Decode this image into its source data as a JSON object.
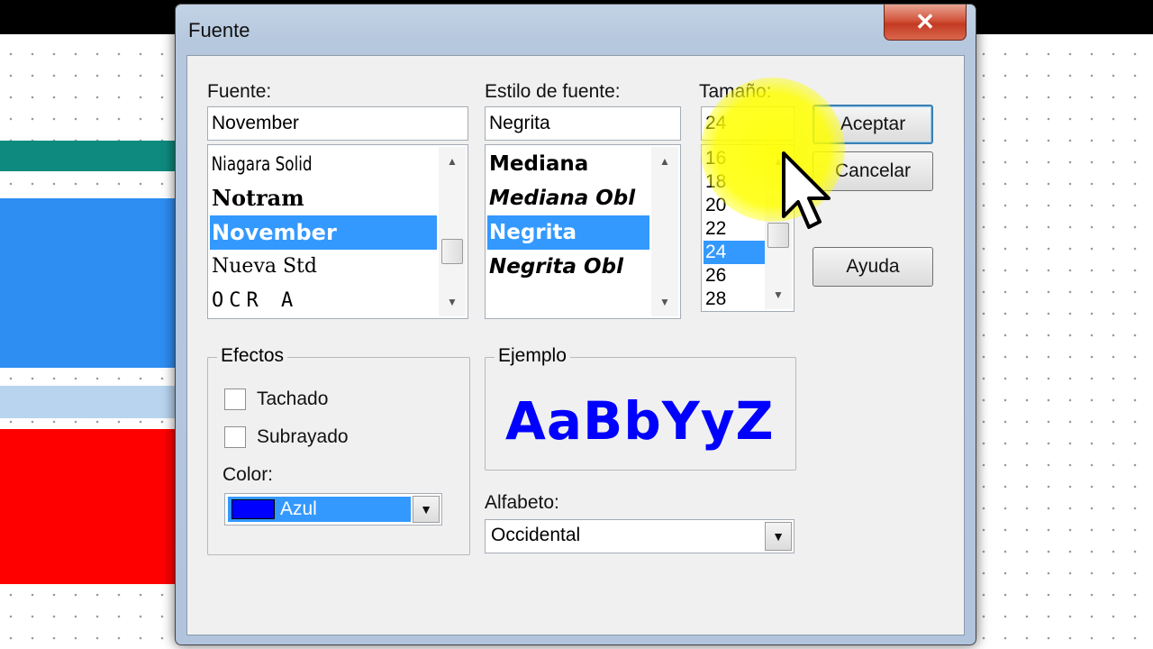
{
  "dialog": {
    "title": "Fuente",
    "close_icon": "close-x-icon"
  },
  "font": {
    "label": "Fuente:",
    "value": "November",
    "items": [
      "Niagara Solid",
      "Notram",
      "November",
      "Nueva Std",
      "OCR A"
    ],
    "selected_index": 2
  },
  "style": {
    "label": "Estilo de fuente:",
    "value": "Negrita",
    "items": [
      "Mediana",
      "Mediana Obl",
      "Negrita",
      "Negrita Obl"
    ],
    "selected_index": 2
  },
  "size": {
    "label": "Tamaño:",
    "value": "24",
    "items": [
      "16",
      "18",
      "20",
      "22",
      "24",
      "26",
      "28"
    ],
    "selected_index": 4
  },
  "buttons": {
    "ok": "Aceptar",
    "cancel": "Cancelar",
    "help": "Ayuda"
  },
  "effects": {
    "legend": "Efectos",
    "strikeout_label": "Tachado",
    "strikeout_checked": false,
    "underline_label": "Subrayado",
    "underline_checked": false,
    "color_label": "Color:",
    "color_value": "Azul",
    "color_swatch": "#0000ff"
  },
  "sample": {
    "legend": "Ejemplo",
    "text": "AaBbYyZz",
    "color": "#0000ff"
  },
  "script": {
    "label": "Alfabeto:",
    "value": "Occidental"
  },
  "colors": {
    "selection": "#3399ff",
    "highlight": "#ffff00"
  },
  "icons": {
    "scroll_up": "up-arrow-icon",
    "scroll_down": "down-arrow-icon",
    "dropdown": "dropdown-arrow-icon",
    "cursor": "mouse-pointer-icon"
  }
}
